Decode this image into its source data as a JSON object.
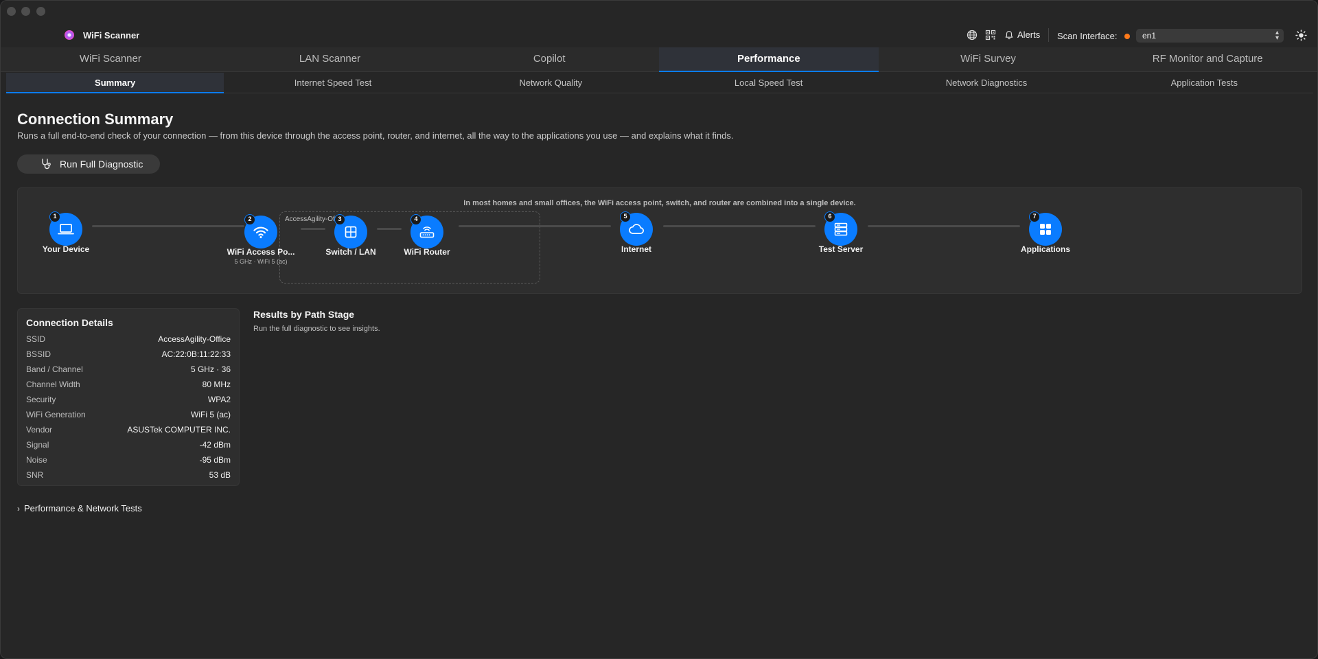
{
  "app": {
    "title": "WiFi Scanner"
  },
  "toolbar": {
    "alerts_label": "Alerts",
    "scan_interface_label": "Scan Interface:",
    "scan_interface_value": "en1",
    "status_dot_color": "#ff7a1a"
  },
  "main_tabs": [
    {
      "label": "WiFi Scanner"
    },
    {
      "label": "LAN Scanner"
    },
    {
      "label": "Copilot"
    },
    {
      "label": "Performance",
      "active": true
    },
    {
      "label": "WiFi Survey"
    },
    {
      "label": "RF Monitor and Capture"
    }
  ],
  "sub_tabs": [
    {
      "label": "Summary",
      "active": true
    },
    {
      "label": "Internet Speed Test"
    },
    {
      "label": "Network Quality"
    },
    {
      "label": "Local Speed Test"
    },
    {
      "label": "Network Diagnostics"
    },
    {
      "label": "Application Tests"
    }
  ],
  "page": {
    "title": "Connection Summary",
    "subtitle": "Runs a full end-to-end check of your connection — from this device through the access point, router, and internet, all the way to the applications you use — and explains what it finds.",
    "run_button": "Run Full Diagnostic"
  },
  "path": {
    "note": "In most homes and small offices, the WiFi access point, switch, and router are combined into a single device.",
    "group_label": "AccessAgility-Office",
    "nodes": [
      {
        "num": "1",
        "label": "Your Device",
        "icon": "laptop-icon"
      },
      {
        "num": "2",
        "label": "WiFi Access Po...",
        "sub": "5 GHz · WiFi 5 (ac)",
        "icon": "wifi-icon"
      },
      {
        "num": "3",
        "label": "Switch / LAN",
        "icon": "switch-icon"
      },
      {
        "num": "4",
        "label": "WiFi Router",
        "icon": "router-icon"
      },
      {
        "num": "5",
        "label": "Internet",
        "icon": "cloud-icon"
      },
      {
        "num": "6",
        "label": "Test Server",
        "icon": "server-icon"
      },
      {
        "num": "7",
        "label": "Applications",
        "icon": "apps-grid-icon"
      }
    ],
    "accent_color": "#0a7cff"
  },
  "details": {
    "title": "Connection Details",
    "rows": [
      {
        "key": "SSID",
        "value": "AccessAgility-Office"
      },
      {
        "key": "BSSID",
        "value": "AC:22:0B:11:22:33"
      },
      {
        "key": "Band / Channel",
        "value": "5 GHz · 36"
      },
      {
        "key": "Channel Width",
        "value": "80 MHz"
      },
      {
        "key": "Security",
        "value": "WPA2"
      },
      {
        "key": "WiFi Generation",
        "value": "WiFi 5 (ac)"
      },
      {
        "key": "Vendor",
        "value": "ASUSTek COMPUTER INC."
      },
      {
        "key": "Signal",
        "value": "-42 dBm"
      },
      {
        "key": "Noise",
        "value": "-95 dBm"
      },
      {
        "key": "SNR",
        "value": "53 dB"
      }
    ]
  },
  "results": {
    "title": "Results by Path Stage",
    "empty_text": "Run the full diagnostic to see insights."
  },
  "disclosure": {
    "label": "Performance & Network Tests"
  }
}
